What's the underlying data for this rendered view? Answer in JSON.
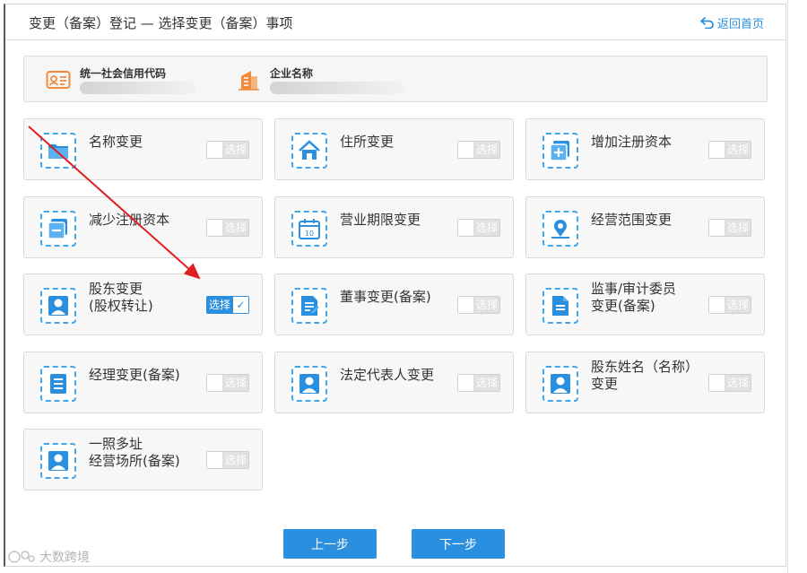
{
  "page": {
    "title": "变更（备案）登记 — 选择变更（备案）事项",
    "back_label": "返回首页"
  },
  "info": {
    "credit_code_label": "统一社会信用代码",
    "company_name_label": "企业名称"
  },
  "items": [
    {
      "label": "名称变更",
      "icon": "folder-icon",
      "selected": false,
      "toggle_label": "选择"
    },
    {
      "label": "住所变更",
      "icon": "home-icon",
      "selected": false,
      "toggle_label": "选择"
    },
    {
      "label": "增加注册资本",
      "icon": "add-icon",
      "selected": false,
      "toggle_label": "选择"
    },
    {
      "label": "减少注册资本",
      "icon": "minus-icon",
      "selected": false,
      "toggle_label": "选择"
    },
    {
      "label": "营业期限变更",
      "icon": "calendar-icon",
      "selected": false,
      "toggle_label": "选择"
    },
    {
      "label": "经营范围变更",
      "icon": "location-icon",
      "selected": false,
      "toggle_label": "选择"
    },
    {
      "label": "股东变更\n(股权转让)",
      "icon": "person-icon",
      "selected": true,
      "toggle_label": "选择"
    },
    {
      "label": "董事变更(备案)",
      "icon": "edit-document-icon",
      "selected": false,
      "toggle_label": "选择"
    },
    {
      "label": "监事/审计委员\n变更(备案)",
      "icon": "document-icon",
      "selected": false,
      "toggle_label": "选择"
    },
    {
      "label": "经理变更(备案)",
      "icon": "list-icon",
      "selected": false,
      "toggle_label": "选择"
    },
    {
      "label": "法定代表人变更",
      "icon": "person-icon",
      "selected": false,
      "toggle_label": "选择"
    },
    {
      "label": "股东姓名（名称）\n变更",
      "icon": "person-icon",
      "selected": false,
      "toggle_label": "选择"
    },
    {
      "label": "一照多址\n经营场所(备案)",
      "icon": "person-icon",
      "selected": false,
      "toggle_label": "选择"
    }
  ],
  "buttons": {
    "prev": "上一步",
    "next": "下一步"
  },
  "watermark": "大数跨境",
  "colors": {
    "accent": "#2b8fe0",
    "annotation_arrow": "#e02020"
  }
}
